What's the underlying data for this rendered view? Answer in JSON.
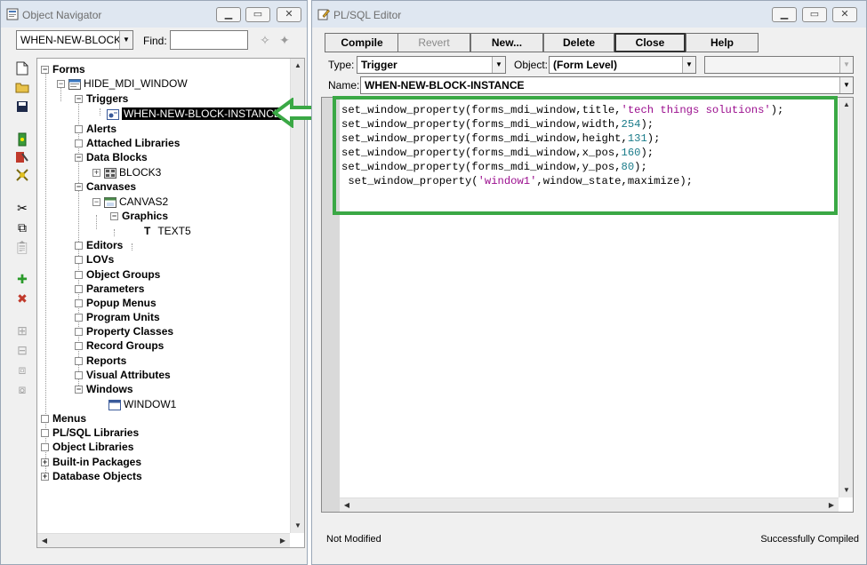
{
  "navigator": {
    "title": "Object Navigator",
    "combo_value": "WHEN-NEW-BLOCK",
    "find_label": "Find:",
    "find_value": "",
    "tree": {
      "forms": "Forms",
      "module": "HIDE_MDI_WINDOW",
      "triggers": "Triggers",
      "trigger_selected": "WHEN-NEW-BLOCK-INSTANCE",
      "alerts": "Alerts",
      "attached_libraries": "Attached Libraries",
      "data_blocks": "Data Blocks",
      "block3": "BLOCK3",
      "canvases": "Canvases",
      "canvas2": "CANVAS2",
      "graphics": "Graphics",
      "text5_glyph": "T",
      "text5": "TEXT5",
      "editors": "Editors",
      "lovs": "LOVs",
      "object_groups": "Object Groups",
      "parameters": "Parameters",
      "popup_menus": "Popup Menus",
      "program_units": "Program Units",
      "property_classes": "Property Classes",
      "record_groups": "Record Groups",
      "reports": "Reports",
      "visual_attributes": "Visual Attributes",
      "windows": "Windows",
      "window1": "WINDOW1",
      "menus": "Menus",
      "plsql_libraries": "PL/SQL Libraries",
      "object_libraries": "Object Libraries",
      "builtin_packages": "Built-in Packages",
      "database_objects": "Database Objects"
    }
  },
  "editor": {
    "title": "PL/SQL Editor",
    "buttons": {
      "compile": "Compile",
      "revert": "Revert",
      "new": "New...",
      "delete": "Delete",
      "close": "Close",
      "help": "Help"
    },
    "type_label": "Type:",
    "type_value": "Trigger",
    "object_label": "Object:",
    "object_value": "(Form Level)",
    "object2_value": "",
    "name_label": "Name:",
    "name_value": "WHEN-NEW-BLOCK-INSTANCE",
    "code_lines": [
      "set_window_property(forms_mdi_window,title,'tech things solutions');",
      "set_window_property(forms_mdi_window,width,254);",
      "set_window_property(forms_mdi_window,height,131);",
      "set_window_property(forms_mdi_window,x_pos,160);",
      "set_window_property(forms_mdi_window,y_pos,80);",
      " set_window_property('window1',window_state,maximize);"
    ],
    "status_left": "Not Modified",
    "status_right": "Successfully Compiled"
  },
  "colors": {
    "highlight_green": "#3aa845",
    "string_color": "#9b0e8e",
    "number_color": "#1b7c8a"
  }
}
